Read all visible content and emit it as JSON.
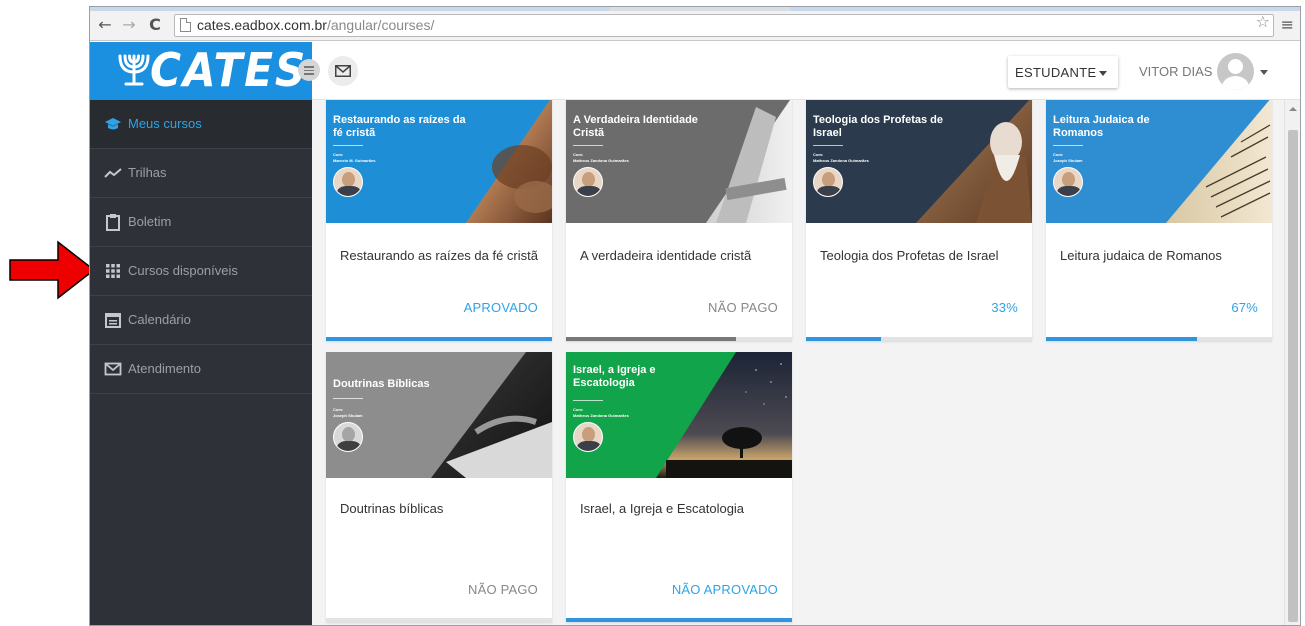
{
  "browser": {
    "url_host": "cates.eadbox.com.br",
    "url_path": "/angular/courses/"
  },
  "header": {
    "logo_text": "CATES",
    "role_label": "ESTUDANTE",
    "user_name": "VITOR DIAS"
  },
  "sidebar": {
    "items": [
      {
        "label": "Meus cursos",
        "icon": "graduation-cap-icon",
        "active": true
      },
      {
        "label": "Trilhas",
        "icon": "trend-line-icon",
        "active": false
      },
      {
        "label": "Boletim",
        "icon": "clipboard-icon",
        "active": false
      },
      {
        "label": "Cursos disponíveis",
        "icon": "grid-icon",
        "active": false
      },
      {
        "label": "Calendário",
        "icon": "calendar-icon",
        "active": false
      },
      {
        "label": "Atendimento",
        "icon": "envelope-icon",
        "active": false
      }
    ]
  },
  "courses": [
    {
      "image_title": "Restaurando as raízes da fé cristã",
      "image_com": "Com:",
      "image_author": "Marcelo M. Guimarães",
      "name": "Restaurando as raízes da fé cristã",
      "status": "APROVADO",
      "progress": 1.0,
      "status_color": "#2fa3e6",
      "bar_color": "#2f95e0"
    },
    {
      "image_title": "A Verdadeira Identidade Cristã",
      "image_com": "Com:",
      "image_author": "Matheus Zandona Guimarães",
      "name": "A verdadeira identidade cristã",
      "status": "NÃO PAGO",
      "progress": 0.75,
      "status_color": "#888888",
      "bar_color": "#777777"
    },
    {
      "image_title": "Teologia dos Profetas de Israel",
      "image_com": "Com:",
      "image_author": "Matheus Zandona Guimarães",
      "name": "Teologia dos Profetas de Israel",
      "status": "33%",
      "progress": 0.33,
      "status_color": "#2fa3e6",
      "bar_color": "#2f95e0"
    },
    {
      "image_title": "Leitura Judaica de Romanos",
      "image_com": "Com:",
      "image_author": "Joseph Shulam",
      "name": "Leitura judaica de Romanos",
      "status": "67%",
      "progress": 0.67,
      "status_color": "#2fa3e6",
      "bar_color": "#2f95e0"
    },
    {
      "image_title": "Doutrinas Bíblicas",
      "image_com": "Com:",
      "image_author": "Joseph Shulam",
      "name": "Doutrinas bíblicas",
      "status": "NÃO PAGO",
      "progress": 0.0,
      "status_color": "#888888",
      "bar_color": "#777777"
    },
    {
      "image_title": "Israel, a Igreja e Escatologia",
      "image_com": "Com:",
      "image_author": "Matheus Zandona Guimarães",
      "name": "Israel, a Igreja e Escatologia",
      "status": "NÃO APROVADO",
      "progress": 1.0,
      "status_color": "#2fa3e6",
      "bar_color": "#2f95e0"
    }
  ]
}
